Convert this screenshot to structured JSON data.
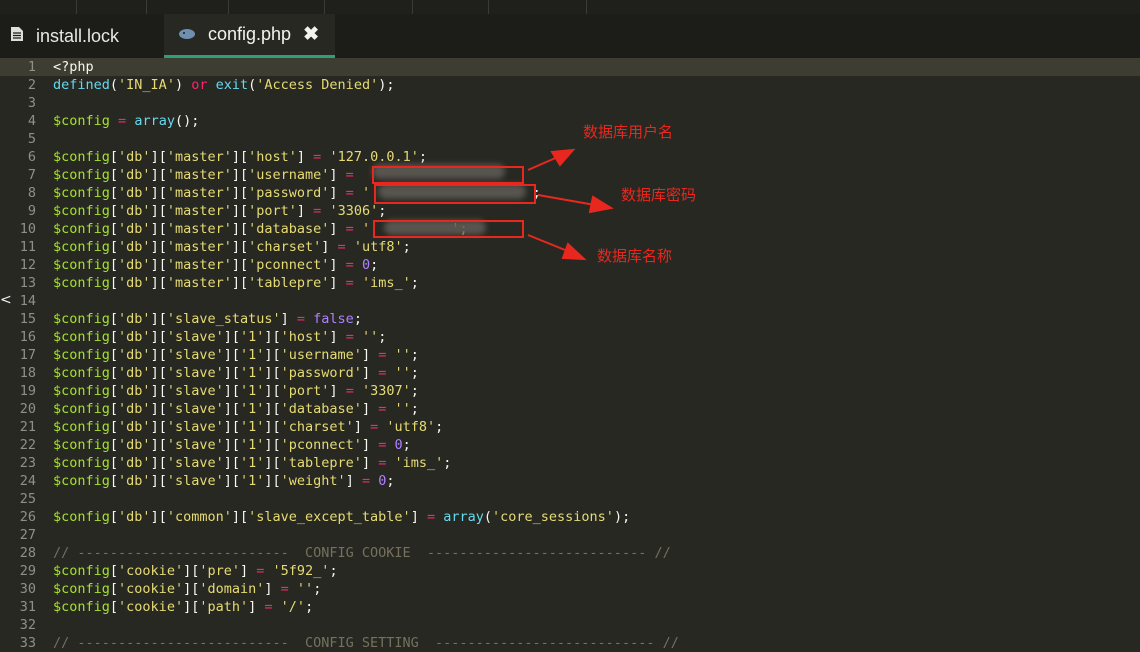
{
  "tabs": [
    {
      "label": "install.lock",
      "icon": "document-icon",
      "active": false
    },
    {
      "label": "config.php",
      "icon": "php-elephant-icon",
      "active": true,
      "close": "✖"
    }
  ],
  "lines": [
    {
      "n": "1",
      "t": [
        [
          "<?php",
          "p"
        ]
      ]
    },
    {
      "n": "2",
      "t": [
        [
          "defined",
          "f"
        ],
        [
          "(",
          "p"
        ],
        [
          "'IN_IA'",
          "s"
        ],
        [
          ") ",
          "p"
        ],
        [
          "or",
          "k"
        ],
        [
          " ",
          "p"
        ],
        [
          "exit",
          "f"
        ],
        [
          "(",
          "p"
        ],
        [
          "'Access Denied'",
          "s"
        ],
        [
          ");",
          "p"
        ]
      ]
    },
    {
      "n": "3",
      "t": []
    },
    {
      "n": "4",
      "t": [
        [
          "$config",
          "v"
        ],
        [
          " ",
          "p"
        ],
        [
          "=",
          "k"
        ],
        [
          " ",
          "p"
        ],
        [
          "array",
          "f"
        ],
        [
          "();",
          "p"
        ]
      ]
    },
    {
      "n": "5",
      "t": []
    },
    {
      "n": "6",
      "t": [
        [
          "$config",
          "v"
        ],
        [
          "[",
          "p"
        ],
        [
          "'db'",
          "s"
        ],
        [
          "][",
          "p"
        ],
        [
          "'master'",
          "s"
        ],
        [
          "][",
          "p"
        ],
        [
          "'host'",
          "s"
        ],
        [
          "] ",
          "p"
        ],
        [
          "=",
          "k"
        ],
        [
          " ",
          "p"
        ],
        [
          "'127.0.0.1'",
          "s"
        ],
        [
          ";",
          "p"
        ]
      ]
    },
    {
      "n": "7",
      "t": [
        [
          "$config",
          "v"
        ],
        [
          "[",
          "p"
        ],
        [
          "'db'",
          "s"
        ],
        [
          "][",
          "p"
        ],
        [
          "'master'",
          "s"
        ],
        [
          "][",
          "p"
        ],
        [
          "'username'",
          "s"
        ],
        [
          "] ",
          "p"
        ],
        [
          "=",
          "k"
        ],
        [
          " ",
          "p"
        ]
      ]
    },
    {
      "n": "8",
      "t": [
        [
          "$config",
          "v"
        ],
        [
          "[",
          "p"
        ],
        [
          "'db'",
          "s"
        ],
        [
          "][",
          "p"
        ],
        [
          "'master'",
          "s"
        ],
        [
          "][",
          "p"
        ],
        [
          "'password'",
          "s"
        ],
        [
          "] ",
          "p"
        ],
        [
          "=",
          "k"
        ],
        [
          " ",
          "p"
        ],
        [
          "'",
          "s"
        ],
        [
          "                    ",
          "p"
        ],
        [
          ";",
          "p"
        ]
      ]
    },
    {
      "n": "9",
      "t": [
        [
          "$config",
          "v"
        ],
        [
          "[",
          "p"
        ],
        [
          "'db'",
          "s"
        ],
        [
          "][",
          "p"
        ],
        [
          "'master'",
          "s"
        ],
        [
          "][",
          "p"
        ],
        [
          "'port'",
          "s"
        ],
        [
          "] ",
          "p"
        ],
        [
          "=",
          "k"
        ],
        [
          " ",
          "p"
        ],
        [
          "'3306'",
          "s"
        ],
        [
          ";",
          "p"
        ]
      ]
    },
    {
      "n": "10",
      "t": [
        [
          "$config",
          "v"
        ],
        [
          "[",
          "p"
        ],
        [
          "'db'",
          "s"
        ],
        [
          "][",
          "p"
        ],
        [
          "'master'",
          "s"
        ],
        [
          "][",
          "p"
        ],
        [
          "'database'",
          "s"
        ],
        [
          "] ",
          "p"
        ],
        [
          "=",
          "k"
        ],
        [
          " ",
          "p"
        ],
        [
          "'",
          "s"
        ],
        [
          "          ",
          "p"
        ],
        [
          "';",
          "s"
        ]
      ]
    },
    {
      "n": "11",
      "t": [
        [
          "$config",
          "v"
        ],
        [
          "[",
          "p"
        ],
        [
          "'db'",
          "s"
        ],
        [
          "][",
          "p"
        ],
        [
          "'master'",
          "s"
        ],
        [
          "][",
          "p"
        ],
        [
          "'charset'",
          "s"
        ],
        [
          "] ",
          "p"
        ],
        [
          "=",
          "k"
        ],
        [
          " ",
          "p"
        ],
        [
          "'utf8'",
          "s"
        ],
        [
          ";",
          "p"
        ]
      ]
    },
    {
      "n": "12",
      "t": [
        [
          "$config",
          "v"
        ],
        [
          "[",
          "p"
        ],
        [
          "'db'",
          "s"
        ],
        [
          "][",
          "p"
        ],
        [
          "'master'",
          "s"
        ],
        [
          "][",
          "p"
        ],
        [
          "'pconnect'",
          "s"
        ],
        [
          "] ",
          "p"
        ],
        [
          "=",
          "k"
        ],
        [
          " ",
          "p"
        ],
        [
          "0",
          "n"
        ],
        [
          ";",
          "p"
        ]
      ]
    },
    {
      "n": "13",
      "t": [
        [
          "$config",
          "v"
        ],
        [
          "[",
          "p"
        ],
        [
          "'db'",
          "s"
        ],
        [
          "][",
          "p"
        ],
        [
          "'master'",
          "s"
        ],
        [
          "][",
          "p"
        ],
        [
          "'tablepre'",
          "s"
        ],
        [
          "] ",
          "p"
        ],
        [
          "=",
          "k"
        ],
        [
          " ",
          "p"
        ],
        [
          "'ims_'",
          "s"
        ],
        [
          ";",
          "p"
        ]
      ]
    },
    {
      "n": "14",
      "t": []
    },
    {
      "n": "15",
      "t": [
        [
          "$config",
          "v"
        ],
        [
          "[",
          "p"
        ],
        [
          "'db'",
          "s"
        ],
        [
          "][",
          "p"
        ],
        [
          "'slave_status'",
          "s"
        ],
        [
          "] ",
          "p"
        ],
        [
          "=",
          "k"
        ],
        [
          " ",
          "p"
        ],
        [
          "false",
          "n"
        ],
        [
          ";",
          "p"
        ]
      ]
    },
    {
      "n": "16",
      "t": [
        [
          "$config",
          "v"
        ],
        [
          "[",
          "p"
        ],
        [
          "'db'",
          "s"
        ],
        [
          "][",
          "p"
        ],
        [
          "'slave'",
          "s"
        ],
        [
          "][",
          "p"
        ],
        [
          "'1'",
          "s"
        ],
        [
          "][",
          "p"
        ],
        [
          "'host'",
          "s"
        ],
        [
          "] ",
          "p"
        ],
        [
          "=",
          "k"
        ],
        [
          " ",
          "p"
        ],
        [
          "''",
          "s"
        ],
        [
          ";",
          "p"
        ]
      ]
    },
    {
      "n": "17",
      "t": [
        [
          "$config",
          "v"
        ],
        [
          "[",
          "p"
        ],
        [
          "'db'",
          "s"
        ],
        [
          "][",
          "p"
        ],
        [
          "'slave'",
          "s"
        ],
        [
          "][",
          "p"
        ],
        [
          "'1'",
          "s"
        ],
        [
          "][",
          "p"
        ],
        [
          "'username'",
          "s"
        ],
        [
          "] ",
          "p"
        ],
        [
          "=",
          "k"
        ],
        [
          " ",
          "p"
        ],
        [
          "''",
          "s"
        ],
        [
          ";",
          "p"
        ]
      ]
    },
    {
      "n": "18",
      "t": [
        [
          "$config",
          "v"
        ],
        [
          "[",
          "p"
        ],
        [
          "'db'",
          "s"
        ],
        [
          "][",
          "p"
        ],
        [
          "'slave'",
          "s"
        ],
        [
          "][",
          "p"
        ],
        [
          "'1'",
          "s"
        ],
        [
          "][",
          "p"
        ],
        [
          "'password'",
          "s"
        ],
        [
          "] ",
          "p"
        ],
        [
          "=",
          "k"
        ],
        [
          " ",
          "p"
        ],
        [
          "''",
          "s"
        ],
        [
          ";",
          "p"
        ]
      ]
    },
    {
      "n": "19",
      "t": [
        [
          "$config",
          "v"
        ],
        [
          "[",
          "p"
        ],
        [
          "'db'",
          "s"
        ],
        [
          "][",
          "p"
        ],
        [
          "'slave'",
          "s"
        ],
        [
          "][",
          "p"
        ],
        [
          "'1'",
          "s"
        ],
        [
          "][",
          "p"
        ],
        [
          "'port'",
          "s"
        ],
        [
          "] ",
          "p"
        ],
        [
          "=",
          "k"
        ],
        [
          " ",
          "p"
        ],
        [
          "'3307'",
          "s"
        ],
        [
          ";",
          "p"
        ]
      ]
    },
    {
      "n": "20",
      "t": [
        [
          "$config",
          "v"
        ],
        [
          "[",
          "p"
        ],
        [
          "'db'",
          "s"
        ],
        [
          "][",
          "p"
        ],
        [
          "'slave'",
          "s"
        ],
        [
          "][",
          "p"
        ],
        [
          "'1'",
          "s"
        ],
        [
          "][",
          "p"
        ],
        [
          "'database'",
          "s"
        ],
        [
          "] ",
          "p"
        ],
        [
          "=",
          "k"
        ],
        [
          " ",
          "p"
        ],
        [
          "''",
          "s"
        ],
        [
          ";",
          "p"
        ]
      ]
    },
    {
      "n": "21",
      "t": [
        [
          "$config",
          "v"
        ],
        [
          "[",
          "p"
        ],
        [
          "'db'",
          "s"
        ],
        [
          "][",
          "p"
        ],
        [
          "'slave'",
          "s"
        ],
        [
          "][",
          "p"
        ],
        [
          "'1'",
          "s"
        ],
        [
          "][",
          "p"
        ],
        [
          "'charset'",
          "s"
        ],
        [
          "] ",
          "p"
        ],
        [
          "=",
          "k"
        ],
        [
          " ",
          "p"
        ],
        [
          "'utf8'",
          "s"
        ],
        [
          ";",
          "p"
        ]
      ]
    },
    {
      "n": "22",
      "t": [
        [
          "$config",
          "v"
        ],
        [
          "[",
          "p"
        ],
        [
          "'db'",
          "s"
        ],
        [
          "][",
          "p"
        ],
        [
          "'slave'",
          "s"
        ],
        [
          "][",
          "p"
        ],
        [
          "'1'",
          "s"
        ],
        [
          "][",
          "p"
        ],
        [
          "'pconnect'",
          "s"
        ],
        [
          "] ",
          "p"
        ],
        [
          "=",
          "k"
        ],
        [
          " ",
          "p"
        ],
        [
          "0",
          "n"
        ],
        [
          ";",
          "p"
        ]
      ]
    },
    {
      "n": "23",
      "t": [
        [
          "$config",
          "v"
        ],
        [
          "[",
          "p"
        ],
        [
          "'db'",
          "s"
        ],
        [
          "][",
          "p"
        ],
        [
          "'slave'",
          "s"
        ],
        [
          "][",
          "p"
        ],
        [
          "'1'",
          "s"
        ],
        [
          "][",
          "p"
        ],
        [
          "'tablepre'",
          "s"
        ],
        [
          "] ",
          "p"
        ],
        [
          "=",
          "k"
        ],
        [
          " ",
          "p"
        ],
        [
          "'ims_'",
          "s"
        ],
        [
          ";",
          "p"
        ]
      ]
    },
    {
      "n": "24",
      "t": [
        [
          "$config",
          "v"
        ],
        [
          "[",
          "p"
        ],
        [
          "'db'",
          "s"
        ],
        [
          "][",
          "p"
        ],
        [
          "'slave'",
          "s"
        ],
        [
          "][",
          "p"
        ],
        [
          "'1'",
          "s"
        ],
        [
          "][",
          "p"
        ],
        [
          "'weight'",
          "s"
        ],
        [
          "] ",
          "p"
        ],
        [
          "=",
          "k"
        ],
        [
          " ",
          "p"
        ],
        [
          "0",
          "n"
        ],
        [
          ";",
          "p"
        ]
      ]
    },
    {
      "n": "25",
      "t": []
    },
    {
      "n": "26",
      "t": [
        [
          "$config",
          "v"
        ],
        [
          "[",
          "p"
        ],
        [
          "'db'",
          "s"
        ],
        [
          "][",
          "p"
        ],
        [
          "'common'",
          "s"
        ],
        [
          "][",
          "p"
        ],
        [
          "'slave_except_table'",
          "s"
        ],
        [
          "] ",
          "p"
        ],
        [
          "=",
          "k"
        ],
        [
          " ",
          "p"
        ],
        [
          "array",
          "f"
        ],
        [
          "(",
          "p"
        ],
        [
          "'core_sessions'",
          "s"
        ],
        [
          ");",
          "p"
        ]
      ]
    },
    {
      "n": "27",
      "t": []
    },
    {
      "n": "28",
      "t": [
        [
          "// --------------------------  CONFIG COOKIE  --------------------------- //",
          "c"
        ]
      ]
    },
    {
      "n": "29",
      "t": [
        [
          "$config",
          "v"
        ],
        [
          "[",
          "p"
        ],
        [
          "'cookie'",
          "s"
        ],
        [
          "][",
          "p"
        ],
        [
          "'pre'",
          "s"
        ],
        [
          "] ",
          "p"
        ],
        [
          "=",
          "k"
        ],
        [
          " ",
          "p"
        ],
        [
          "'5f92_'",
          "s"
        ],
        [
          ";",
          "p"
        ]
      ]
    },
    {
      "n": "30",
      "t": [
        [
          "$config",
          "v"
        ],
        [
          "[",
          "p"
        ],
        [
          "'cookie'",
          "s"
        ],
        [
          "][",
          "p"
        ],
        [
          "'domain'",
          "s"
        ],
        [
          "] ",
          "p"
        ],
        [
          "=",
          "k"
        ],
        [
          " ",
          "p"
        ],
        [
          "''",
          "s"
        ],
        [
          ";",
          "p"
        ]
      ]
    },
    {
      "n": "31",
      "t": [
        [
          "$config",
          "v"
        ],
        [
          "[",
          "p"
        ],
        [
          "'cookie'",
          "s"
        ],
        [
          "][",
          "p"
        ],
        [
          "'path'",
          "s"
        ],
        [
          "] ",
          "p"
        ],
        [
          "=",
          "k"
        ],
        [
          " ",
          "p"
        ],
        [
          "'/'",
          "s"
        ],
        [
          ";",
          "p"
        ]
      ]
    },
    {
      "n": "32",
      "t": []
    },
    {
      "n": "33",
      "t": [
        [
          "// --------------------------  CONFIG SETTING  --------------------------- //",
          "c"
        ]
      ]
    }
  ],
  "annotations": {
    "username": "数据库用户名",
    "password": "数据库密码",
    "database": "数据库名称"
  },
  "colors": {
    "background": "#272822",
    "annotation_red": "#e8281f",
    "active_tab_underline": "#2f9e7a"
  },
  "left_edge_glyph": "<"
}
